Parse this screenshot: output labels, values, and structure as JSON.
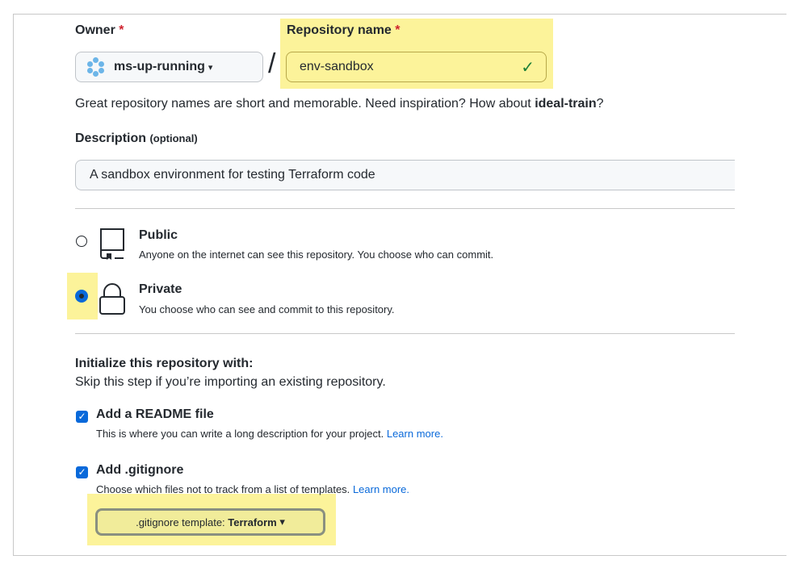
{
  "owner": {
    "label": "Owner",
    "required": "*",
    "value": "ms-up-running",
    "caret": "▾"
  },
  "repo": {
    "label": "Repository name",
    "required": "*",
    "value": "env-sandbox",
    "valid_icon": "✓"
  },
  "hint": {
    "prefix": "Great repository names are short and memorable. Need inspiration? How about ",
    "suggestion": "ideal-train",
    "suffix": "?"
  },
  "description": {
    "label": "Description",
    "optional": "(optional)",
    "value": "A sandbox environment for testing Terraform code"
  },
  "visibility": {
    "public": {
      "title": "Public",
      "desc": "Anyone on the internet can see this repository. You choose who can commit.",
      "selected": false
    },
    "private": {
      "title": "Private",
      "desc": "You choose who can see and commit to this repository.",
      "selected": true
    }
  },
  "init": {
    "title": "Initialize this repository with:",
    "subtitle": "Skip this step if you’re importing an existing repository.",
    "readme": {
      "title": "Add a README file",
      "desc": "This is where you can write a long description for your project.",
      "link": "Learn more.",
      "checked": true
    },
    "gitignore": {
      "title": "Add .gitignore",
      "desc": "Choose which files not to track from a list of templates.",
      "link": "Learn more.",
      "checked": true
    },
    "template_label": ".gitignore template:",
    "template_value": "Terraform",
    "caret": "▾"
  },
  "colors": {
    "highlight": "#fcf39a",
    "accent": "#0969da",
    "required": "#cf222e",
    "success": "#1a7f37"
  }
}
